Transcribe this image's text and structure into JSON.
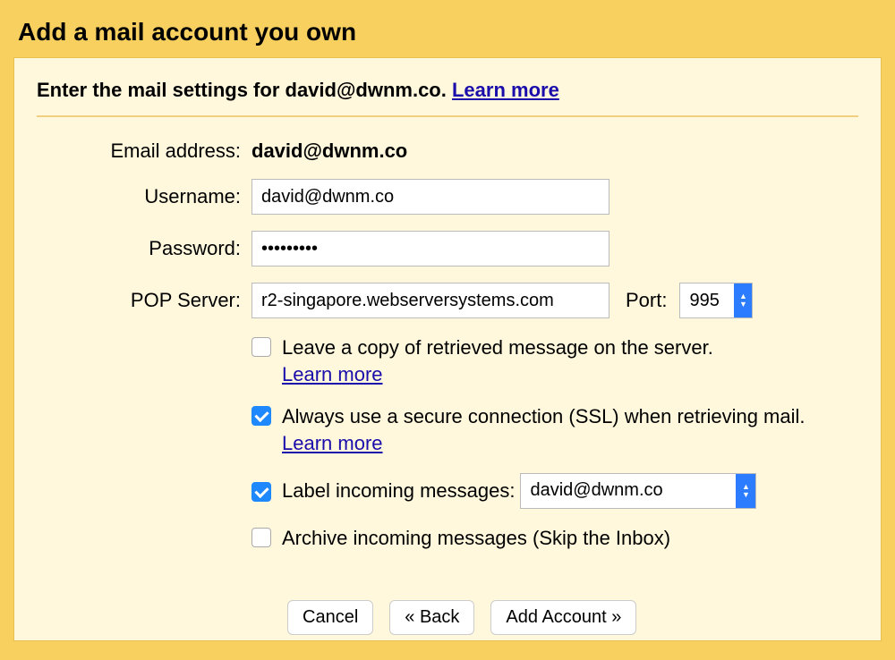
{
  "title": "Add a mail account you own",
  "instruction": {
    "prefix": "Enter the mail settings for ",
    "email": "david@dwnm.co",
    "suffix": ". ",
    "learn_more": "Learn more"
  },
  "form": {
    "email_label": "Email address:",
    "email_value": "david@dwnm.co",
    "username_label": "Username:",
    "username_value": "david@dwnm.co",
    "password_label": "Password:",
    "password_value": "•••••••••",
    "pop_label": "POP Server:",
    "pop_value": "r2-singapore.webserversystems.com",
    "port_label": "Port:",
    "port_value": "995"
  },
  "checkboxes": {
    "leave_copy": {
      "text": "Leave a copy of retrieved message on the server.",
      "learn_more": "Learn more",
      "checked": false
    },
    "ssl": {
      "text_a": "Always use a secure connection (SSL) when retrieving mail. ",
      "learn_more": "Learn more",
      "checked": true
    },
    "label_incoming": {
      "text": "Label incoming messages:",
      "select_value": "david@dwnm.co",
      "checked": true
    },
    "archive": {
      "text": "Archive incoming messages (Skip the Inbox)",
      "checked": false
    }
  },
  "buttons": {
    "cancel": "Cancel",
    "back": "« Back",
    "add": "Add Account »"
  }
}
